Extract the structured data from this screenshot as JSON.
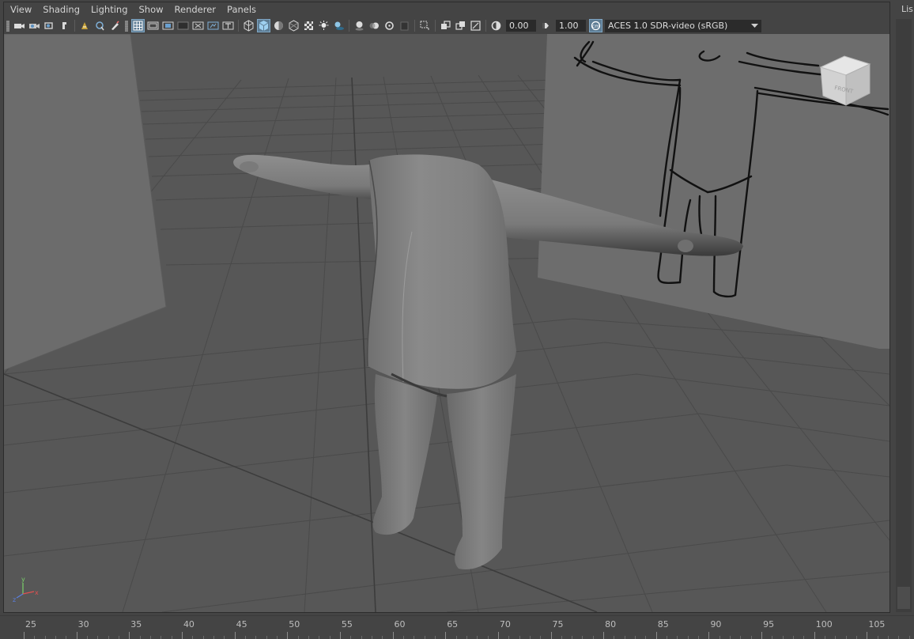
{
  "menu": {
    "items": [
      "View",
      "Shading",
      "Lighting",
      "Show",
      "Renderer",
      "Panels"
    ]
  },
  "toolbar": {
    "exposure_value": "0.00",
    "gamma_value": "1.00",
    "color_space": "ACES 1.0 SDR-video (sRGB)",
    "icon_groups": [
      [
        "camera-select-icon",
        "camera-attributes-icon",
        "bookmarks-icon",
        "image-plane-icon",
        "2d-pan-zoom-icon",
        "grease-pencil-icon"
      ],
      [
        "grid-icon",
        "film-gate-icon",
        "resolution-gate-icon",
        "gate-mask-icon",
        "field-chart-icon",
        "safe-action-icon"
      ],
      [
        "wireframe-icon",
        "smooth-shade-icon",
        "flat-shade-icon",
        "bounding-box-icon",
        "textured-icon",
        "use-all-lights-icon",
        "shadows-icon"
      ],
      [
        "screen-space-ao-icon",
        "motion-blur-icon",
        "multisample-aa-icon",
        "depth-of-field-icon"
      ],
      [
        "isolate-select-icon"
      ],
      [
        "xray-icon",
        "xray-active-components-icon",
        "xray-joints-icon"
      ],
      [
        "exposure-icon"
      ],
      [
        "gamma-icon"
      ],
      [
        "color-management-icon"
      ]
    ],
    "active_icons": [
      "grid-icon",
      "smooth-shade-icon",
      "color-management-icon"
    ]
  },
  "viewcube": {
    "face_label": "FRONT"
  },
  "axis_indicator": {
    "x_label": "x",
    "y_label": "y",
    "z_label": "z"
  },
  "right_panel": {
    "label": "Lis"
  },
  "time_ruler": {
    "ticks": [
      "25",
      "30",
      "35",
      "40",
      "45",
      "50",
      "55",
      "60",
      "65",
      "70",
      "75",
      "80",
      "85",
      "90",
      "95",
      "100",
      "105"
    ]
  },
  "colors": {
    "accent": "#5d7c94",
    "viewport_bg": "#565656",
    "ui_bg": "#444444",
    "field_bg": "#2a2a2a"
  }
}
